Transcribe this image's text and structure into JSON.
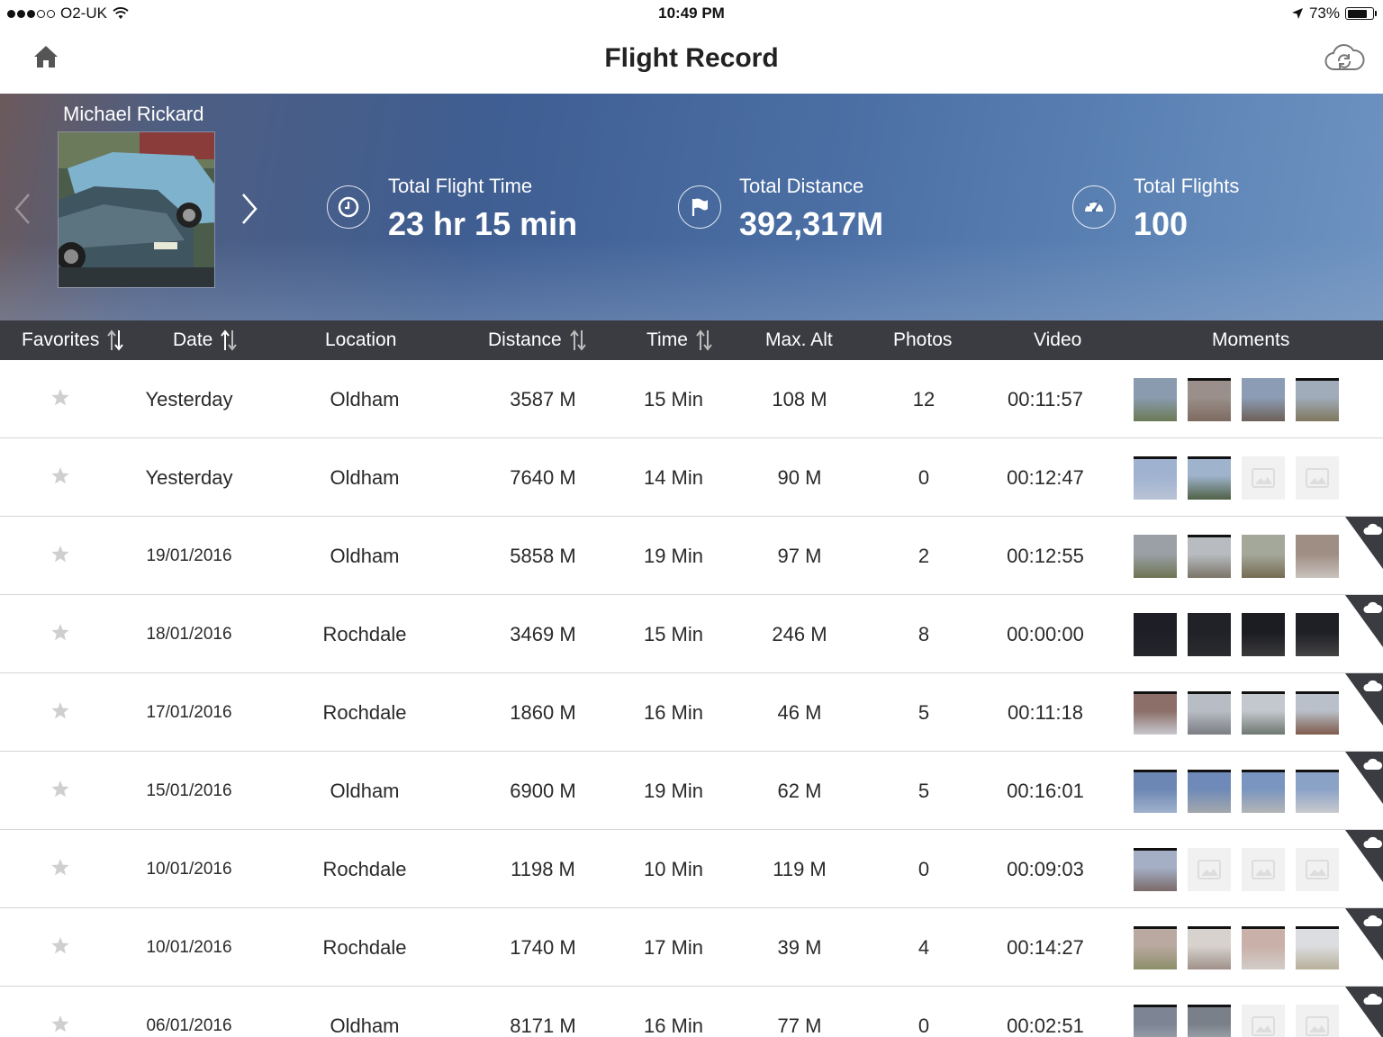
{
  "status_bar": {
    "carrier": "O2-UK",
    "time": "10:49 PM",
    "battery": "73%"
  },
  "nav": {
    "title": "Flight Record"
  },
  "profile": {
    "name": "Michael Rickard"
  },
  "stats": [
    {
      "label": "Total Flight Time",
      "value": "23 hr 15 min",
      "icon": "clock-icon"
    },
    {
      "label": "Total Distance",
      "value": "392,317M",
      "icon": "flag-icon"
    },
    {
      "label": "Total Flights",
      "value": "100",
      "icon": "speedometer-icon"
    }
  ],
  "columns": {
    "favorites": "Favorites",
    "date": "Date",
    "location": "Location",
    "distance": "Distance",
    "time": "Time",
    "max_alt": "Max. Alt",
    "photos": "Photos",
    "video": "Video",
    "moments": "Moments"
  },
  "rows": [
    {
      "date": "Yesterday",
      "location": "Oldham",
      "distance": "3587 M",
      "time": "15 Min",
      "max_alt": "108 M",
      "photos": "12",
      "video": "00:11:57",
      "cloud": false,
      "moments": [
        {
          "c1": "#8a9bb0",
          "c2": "#6b7a55"
        },
        {
          "c1": "#9a8f8a",
          "c2": "#7d6a60"
        },
        {
          "c1": "#8c9cb5",
          "c2": "#6d6058"
        },
        {
          "c1": "#a0acba",
          "c2": "#80775e"
        }
      ]
    },
    {
      "date": "Yesterday",
      "location": "Oldham",
      "distance": "7640 M",
      "time": "14 Min",
      "max_alt": "90 M",
      "photos": "0",
      "video": "00:12:47",
      "cloud": false,
      "moments": [
        {
          "c1": "#9fb2d0",
          "c2": "#b9c3d6"
        },
        {
          "c1": "#9fb3cc",
          "c2": "#4f6145"
        },
        null,
        null
      ]
    },
    {
      "date": "19/01/2016",
      "location": "Oldham",
      "distance": "5858 M",
      "time": "19 Min",
      "max_alt": "97 M",
      "photos": "2",
      "video": "00:12:55",
      "cloud": true,
      "moments": [
        {
          "c1": "#9aa0a6",
          "c2": "#6e7452"
        },
        {
          "c1": "#b8bcc0",
          "c2": "#7b7468"
        },
        {
          "c1": "#a4a89a",
          "c2": "#766b52"
        },
        {
          "c1": "#9e8e84",
          "c2": "#c9c2bd"
        }
      ]
    },
    {
      "date": "18/01/2016",
      "location": "Rochdale",
      "distance": "3469 M",
      "time": "15 Min",
      "max_alt": "246 M",
      "photos": "8",
      "video": "00:00:00",
      "cloud": true,
      "moments": [
        {
          "c1": "#1e1f26",
          "c2": "#25262c"
        },
        {
          "c1": "#202228",
          "c2": "#2a2b2e"
        },
        {
          "c1": "#1c1d22",
          "c2": "#3a3a3c"
        },
        {
          "c1": "#1f2026",
          "c2": "#444"
        }
      ]
    },
    {
      "date": "17/01/2016",
      "location": "Rochdale",
      "distance": "1860 M",
      "time": "16 Min",
      "max_alt": "46 M",
      "photos": "5",
      "video": "00:11:18",
      "cloud": true,
      "moments": [
        {
          "c1": "#8b6f68",
          "c2": "#c7c7cd"
        },
        {
          "c1": "#b8bcc4",
          "c2": "#7a7d82"
        },
        {
          "c1": "#c3c8cf",
          "c2": "#6e7770"
        },
        {
          "c1": "#b9c0c9",
          "c2": "#7e5a4c"
        }
      ]
    },
    {
      "date": "15/01/2016",
      "location": "Oldham",
      "distance": "6900 M",
      "time": "19 Min",
      "max_alt": "62 M",
      "photos": "5",
      "video": "00:16:01",
      "cloud": true,
      "moments": [
        {
          "c1": "#6d87b4",
          "c2": "#9fb1cc"
        },
        {
          "c1": "#6f8ab8",
          "c2": "#a2a7ad"
        },
        {
          "c1": "#7a95c0",
          "c2": "#b3b5b6"
        },
        {
          "c1": "#8ba2c7",
          "c2": "#c8cace"
        }
      ]
    },
    {
      "date": "10/01/2016",
      "location": "Rochdale",
      "distance": "1198 M",
      "time": "10 Min",
      "max_alt": "119 M",
      "photos": "0",
      "video": "00:09:03",
      "cloud": true,
      "moments": [
        {
          "c1": "#a4afc6",
          "c2": "#7a6a6a"
        },
        null,
        null,
        null
      ]
    },
    {
      "date": "10/01/2016",
      "location": "Rochdale",
      "distance": "1740 M",
      "time": "17 Min",
      "max_alt": "39 M",
      "photos": "4",
      "video": "00:14:27",
      "cloud": true,
      "moments": [
        {
          "c1": "#b9a9a0",
          "c2": "#8c8f6a"
        },
        {
          "c1": "#d7d2cd",
          "c2": "#a0918a"
        },
        {
          "c1": "#c9b0a8",
          "c2": "#d2ccc8"
        },
        {
          "c1": "#dcdde0",
          "c2": "#b7b09a"
        }
      ]
    },
    {
      "date": "06/01/2016",
      "location": "Oldham",
      "distance": "8171 M",
      "time": "16 Min",
      "max_alt": "77 M",
      "photos": "0",
      "video": "00:02:51",
      "cloud": true,
      "moments": [
        {
          "c1": "#7d8594",
          "c2": "#a6abb4"
        },
        {
          "c1": "#7a8089",
          "c2": "#b0b4ba"
        },
        null,
        null
      ]
    }
  ]
}
